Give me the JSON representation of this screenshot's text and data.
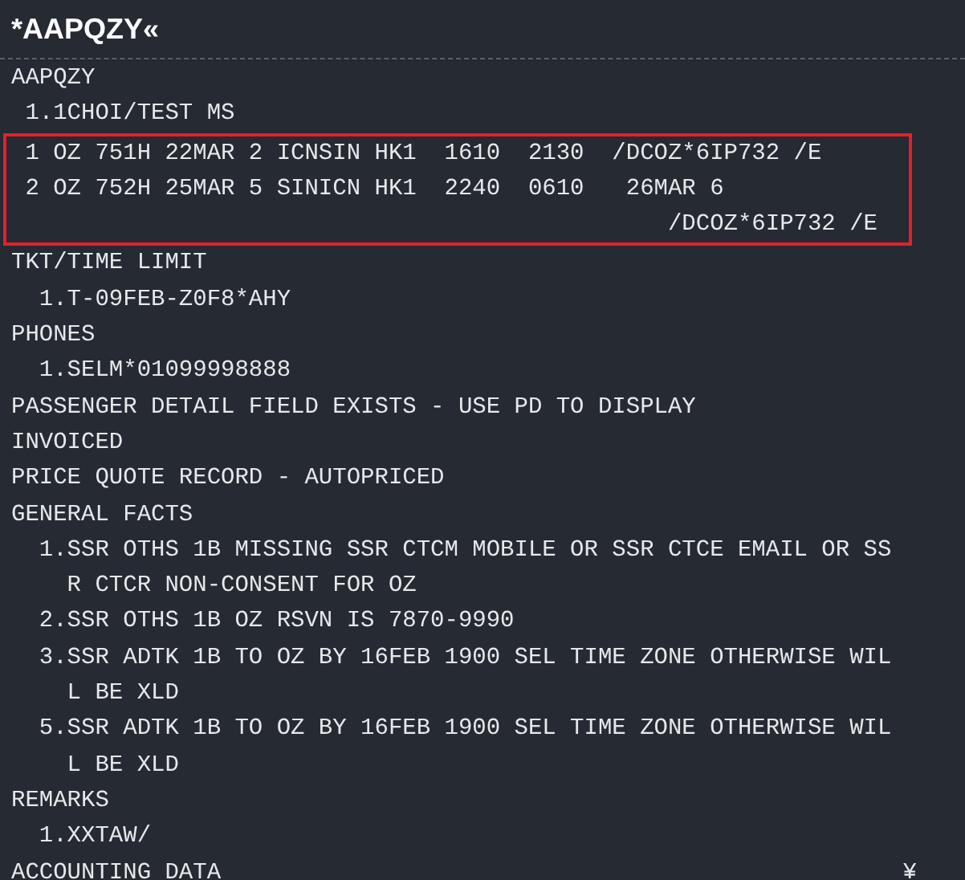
{
  "command": "*AAPQZY«",
  "blocks": [
    {
      "kind": "plain",
      "lines": [
        {
          "text": "AAPQZY"
        },
        {
          "text": " 1.1CHOI/TEST MS"
        }
      ]
    },
    {
      "kind": "boxed",
      "lines": [
        {
          "text": " 1 OZ 751H 22MAR 2 ICNSIN HK1  1610  2130  /DCOZ*6IP732 /E"
        },
        {
          "text": " 2 OZ 752H 25MAR 5 SINICN HK1  2240  0610   26MAR 6"
        },
        {
          "text": "                                               /DCOZ*6IP732 /E"
        }
      ]
    },
    {
      "kind": "plain",
      "lines": [
        {
          "text": "TKT/TIME LIMIT"
        },
        {
          "text": "  1.T-09FEB-Z0F8*AHY"
        },
        {
          "text": "PHONES"
        },
        {
          "text": "  1.SELM*01099998888"
        },
        {
          "text": "PASSENGER DETAIL FIELD EXISTS - USE PD TO DISPLAY"
        },
        {
          "text": "INVOICED"
        },
        {
          "text": "PRICE QUOTE RECORD - AUTOPRICED"
        },
        {
          "text": "GENERAL FACTS"
        },
        {
          "text": "  1.SSR OTHS 1B MISSING SSR CTCM MOBILE OR SSR CTCE EMAIL OR SS"
        },
        {
          "text": "    R CTCR NON-CONSENT FOR OZ"
        },
        {
          "text": "  2.SSR OTHS 1B OZ RSVN IS 7870-9990"
        },
        {
          "text": "  3.SSR ADTK 1B TO OZ BY 16FEB 1900 SEL TIME ZONE OTHERWISE WIL"
        },
        {
          "text": "    L BE XLD"
        },
        {
          "text": "  5.SSR ADTK 1B TO OZ BY 16FEB 1900 SEL TIME ZONE OTHERWISE WIL"
        },
        {
          "text": "    L BE XLD"
        },
        {
          "text": "REMARKS"
        },
        {
          "text": "  1.XXTAW/"
        },
        {
          "text": "ACCOUNTING DATA",
          "trailing": "¥"
        }
      ]
    }
  ]
}
